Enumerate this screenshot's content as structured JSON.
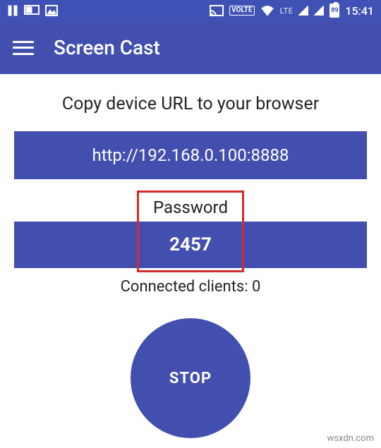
{
  "statusbar": {
    "icons": {
      "pause": "pause-icon",
      "cast_device": "cast-device-icon",
      "image": "image-icon",
      "cast": "cast-icon",
      "volte": "VOLTE",
      "wifi": "wifi-icon",
      "lte": "LTE",
      "signal1": "signal-icon",
      "signal2": "signal-icon",
      "battery_pct": "89"
    },
    "time": "15:41"
  },
  "appbar": {
    "title": "Screen Cast"
  },
  "main": {
    "instruction": "Copy device URL to your browser",
    "url": "http://192.168.0.100:8888",
    "password_label": "Password",
    "password_value": "2457",
    "clients_text": "Connected clients: 0",
    "stop_label": "STOP"
  },
  "watermark": "wsxdn.com",
  "colors": {
    "primary": "#434faf",
    "status": "#3f51b5",
    "highlight": "#d62b2b"
  }
}
